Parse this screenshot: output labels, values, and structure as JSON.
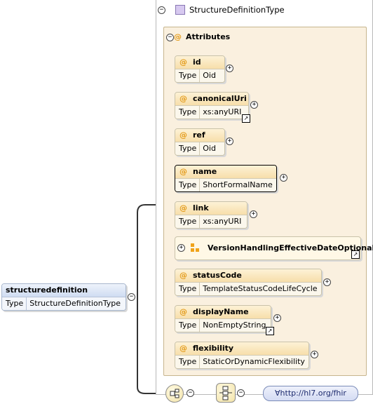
{
  "complex_type": {
    "name": "StructureDefinitionType",
    "collapse": "−"
  },
  "attributes_group": {
    "label": "Attributes",
    "at": "@",
    "collapse": "−"
  },
  "attributes": [
    {
      "name": "id",
      "type_label": "Type",
      "type": "Oid"
    },
    {
      "name": "canonicalUri",
      "type_label": "Type",
      "type": "xs:anyURI"
    },
    {
      "name": "ref",
      "type_label": "Type",
      "type": "Oid"
    },
    {
      "name": "name",
      "type_label": "Type",
      "type": "ShortFormalName"
    },
    {
      "name": "link",
      "type_label": "Type",
      "type": "xs:anyURI"
    },
    {
      "name": "statusCode",
      "type_label": "Type",
      "type": "TemplateStatusCodeLifeCycle"
    },
    {
      "name": "displayName",
      "type_label": "Type",
      "type": "NonEmptyString"
    },
    {
      "name": "flexibility",
      "type_label": "Type",
      "type": "StaticOrDynamicFlexibility"
    }
  ],
  "attribute_group_ref": {
    "name": "VersionHandlingEffectiveDateOptional"
  },
  "root_element": {
    "name": "structuredefinition",
    "type_label": "Type",
    "type": "StructureDefinitionType"
  },
  "any_element": {
    "label": "∀http://hl7.org/fhir"
  },
  "icons": {
    "at": "@",
    "plus": "+",
    "minus": "−",
    "external": "↗"
  },
  "colors": {
    "attribute_header": "#f7deaa",
    "attributes_panel": "#faf0df",
    "element_header": "#cfdcf2",
    "any_fill": "#d4dbf3"
  }
}
